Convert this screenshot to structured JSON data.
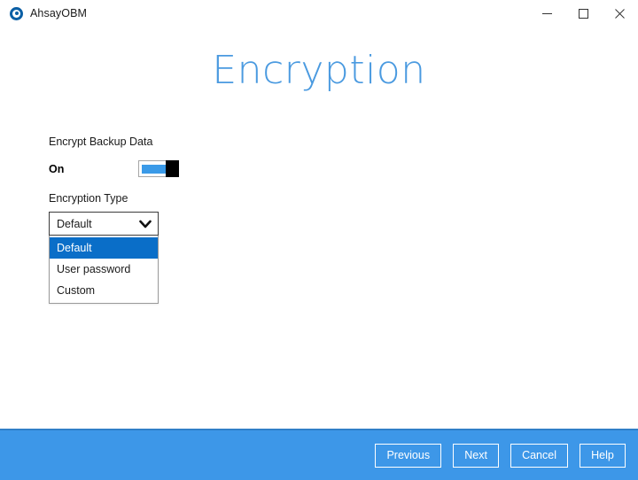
{
  "window": {
    "app_title": "AhsayOBM",
    "app_icon": "target-circle-icon",
    "controls": {
      "minimize": "minimize-icon",
      "maximize": "maximize-icon",
      "close": "close-icon"
    }
  },
  "page": {
    "title": "Encryption",
    "title_color": "#4a9ae0"
  },
  "form": {
    "encrypt_backup_data_label": "Encrypt Backup Data",
    "toggle_state_label": "On",
    "toggle_on": true,
    "toggle_accent_color": "#3a9ae8",
    "encryption_type_label": "Encryption Type",
    "encryption_type_value": "Default",
    "encryption_type_options": [
      "Default",
      "User password",
      "Custom"
    ],
    "encryption_type_selected_index": 0,
    "dropdown_open": true,
    "highlight_color": "#0a6ec8"
  },
  "footer": {
    "background_color": "#3d97e8",
    "buttons": [
      "Previous",
      "Next",
      "Cancel",
      "Help"
    ]
  }
}
